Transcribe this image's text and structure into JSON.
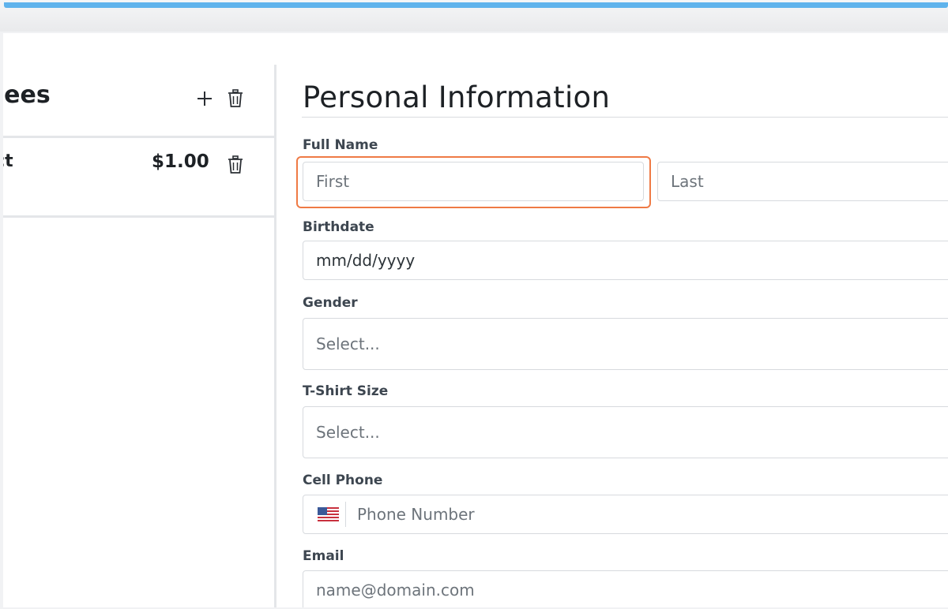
{
  "sidebar": {
    "title": "endees",
    "attendee": {
      "name": "ntact",
      "price": "$1.00"
    }
  },
  "form": {
    "title": "Personal Information",
    "full_name": {
      "label": "Full Name",
      "first_placeholder": "First",
      "last_placeholder": "Last"
    },
    "birthdate": {
      "label": "Birthdate",
      "value": "mm/dd/yyyy"
    },
    "gender": {
      "label": "Gender",
      "placeholder": "Select..."
    },
    "tshirt": {
      "label": "T-Shirt Size",
      "placeholder": "Select..."
    },
    "cell_phone": {
      "label": "Cell Phone",
      "placeholder": "Phone Number",
      "country_icon": "us-flag-icon"
    },
    "email": {
      "label": "Email",
      "placeholder": "name@domain.com"
    }
  },
  "colors": {
    "accent_bar": "#5fb3ec",
    "focus_ring": "#ef7a45"
  }
}
